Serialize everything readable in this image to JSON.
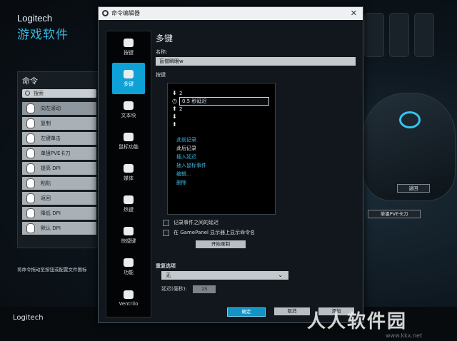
{
  "background_app": {
    "brand": "Logitech",
    "app_name": "游戏软件",
    "commands_title": "命令",
    "search_placeholder": "搜索",
    "commands": [
      "向左滚动",
      "复制",
      "左键单击",
      "单狙PVE卡刀",
      "提高 DPI",
      "粘贴",
      "返回",
      "降低 DPI",
      "默认 DPI"
    ],
    "hint": "将命令拖动至按钮或配置文件图标",
    "footer_brand": "Logitech",
    "mouse_labels": [
      "返回",
      "单狙PVE卡刀"
    ]
  },
  "dialog": {
    "title": "命令编辑器",
    "close": "✕",
    "sidebar": [
      "按键",
      "多键",
      "文本块",
      "鼠标功能",
      "媒体",
      "热键",
      "快捷键",
      "功能",
      "Ventrilo"
    ],
    "selected_index": 1,
    "heading": "多键",
    "name_label": "名称:",
    "name_value": "盲僧瞬眼w",
    "keys_label": "按键",
    "key_rows": [
      {
        "arrow": "⬇",
        "text": "2"
      },
      {
        "arrow": "◷",
        "text": "0.5 秒延迟"
      },
      {
        "arrow": "⬆",
        "text": "2"
      },
      {
        "arrow": "⬇",
        "text": ""
      },
      {
        "arrow": "⬆",
        "text": ""
      }
    ],
    "context_menu": [
      {
        "label": "此前记录",
        "color": "#3fb8e4"
      },
      {
        "label": "此后记录",
        "color": "#e6eaed"
      },
      {
        "label": "插入延迟",
        "color": "#3fb8e4"
      },
      {
        "label": "插入鼠标事件",
        "color": "#3fb8e4"
      },
      {
        "label": "编辑...",
        "color": "#3fb8e4"
      },
      {
        "label": "删除",
        "color": "#3fb8e4"
      }
    ],
    "options": [
      "记录事件之间的延迟",
      "在 GamePanel 显示器上显示命令名"
    ],
    "record_button": "开始录制",
    "repeat_label": "重复选项",
    "repeat_value": "无",
    "delay_label": "延迟(毫秒):",
    "delay_value": "25",
    "ok_button": "确定",
    "cancel_button": "取消",
    "add_button": "添加"
  },
  "watermark": "人人软件园",
  "watermark_url": "www.kkx.net",
  "colors": {
    "accent": "#0ea1d6",
    "menu_link": "#3fb8e4"
  }
}
